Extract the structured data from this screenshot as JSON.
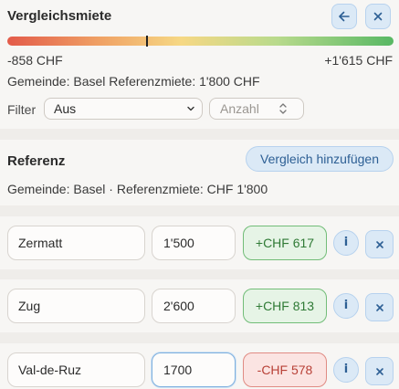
{
  "header": {
    "title": "Vergleichsmiete",
    "back_icon": "arrow-left-icon",
    "close_icon": "close-icon"
  },
  "scale": {
    "min_label": "-858 CHF",
    "max_label": "+1'615 CHF",
    "colors": {
      "low": "#e35b4a",
      "mid": "#f6d884",
      "high": "#58b864"
    }
  },
  "summary": {
    "text": "Gemeinde: Basel Referenzmiete: 1'800 CHF"
  },
  "filter": {
    "label": "Filter",
    "select_value": "Aus",
    "count_placeholder": "Anzahl"
  },
  "reference": {
    "title": "Referenz",
    "add_button": "Vergleich hinzufügen",
    "info": "Gemeinde: Basel · Referenzmiete: CHF 1'800"
  },
  "comparisons": [
    {
      "gemeinde": "Zermatt",
      "miete": "1'500",
      "diff": "+CHF 617",
      "status": "positive",
      "info_label": "i"
    },
    {
      "gemeinde": "Zug",
      "miete": "2'600",
      "diff": "+CHF 813",
      "status": "positive",
      "info_label": "i"
    },
    {
      "gemeinde": "Val-de-Ruz",
      "miete": "1700",
      "diff": "-CHF 578",
      "status": "negative",
      "info_label": "i"
    }
  ],
  "colors": {
    "accent": "#2d5f94",
    "accent_bg": "#dbe9f6",
    "positive": "#2f7a35",
    "negative": "#b84137"
  }
}
